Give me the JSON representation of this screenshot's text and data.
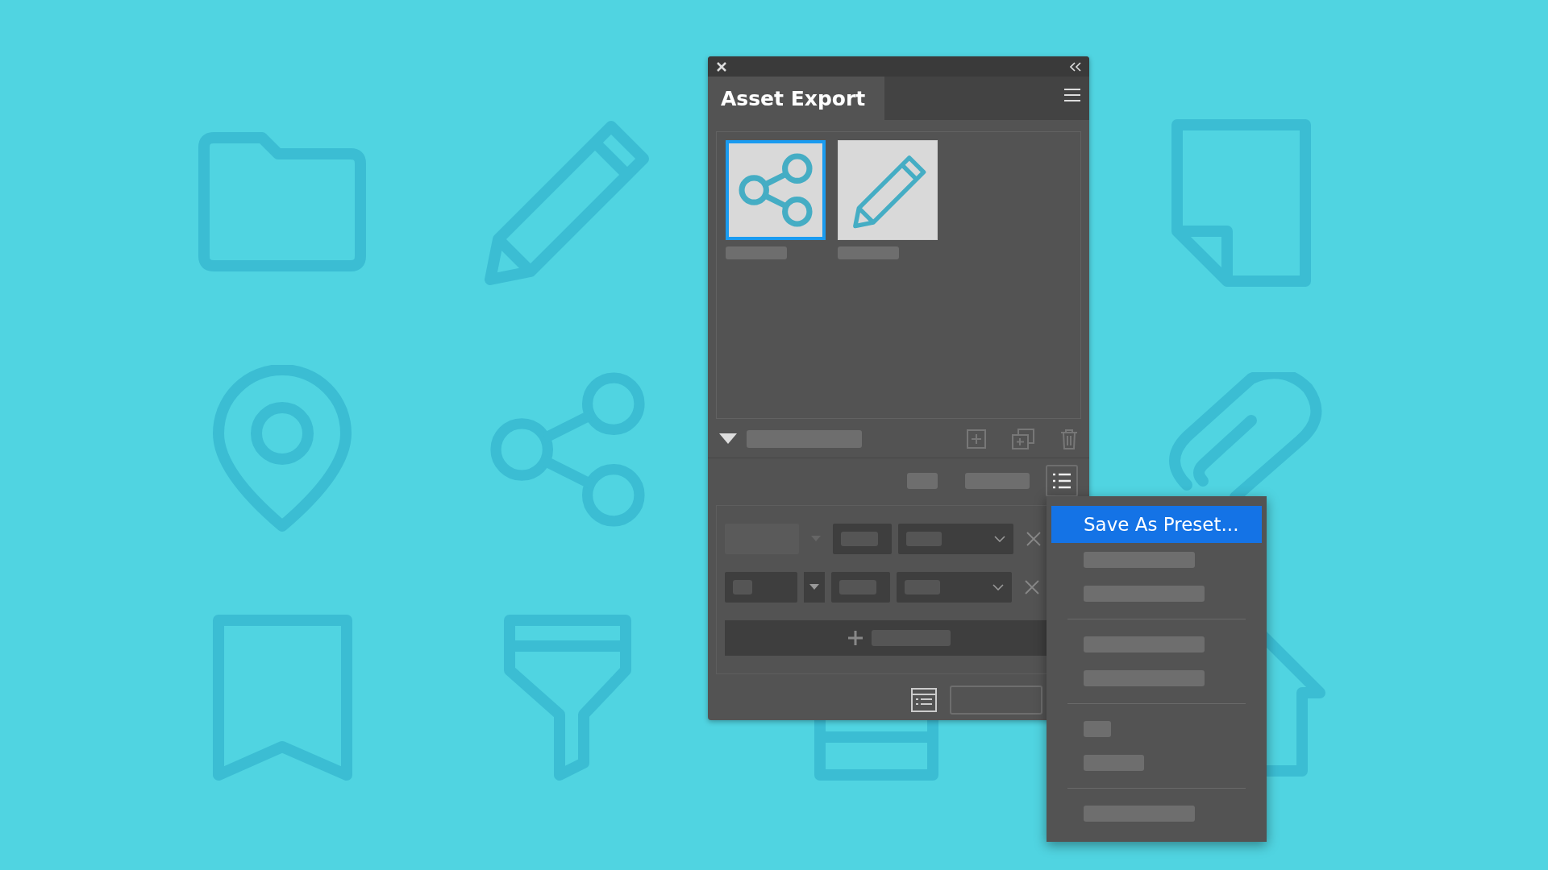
{
  "panel": {
    "title": "Asset Export",
    "assets": [
      {
        "kind": "share",
        "selected": true
      },
      {
        "kind": "pencil",
        "selected": false
      }
    ],
    "export_rows": [
      {
        "disabled": true
      },
      {
        "disabled": false
      }
    ]
  },
  "menu": {
    "items": [
      {
        "kind": "item",
        "label": "Save As Preset...",
        "selected": true
      },
      {
        "kind": "placeholder"
      },
      {
        "kind": "placeholder"
      },
      {
        "kind": "separator"
      },
      {
        "kind": "placeholder"
      },
      {
        "kind": "placeholder"
      },
      {
        "kind": "separator"
      },
      {
        "kind": "placeholder"
      },
      {
        "kind": "placeholder"
      },
      {
        "kind": "separator"
      },
      {
        "kind": "placeholder"
      }
    ]
  }
}
